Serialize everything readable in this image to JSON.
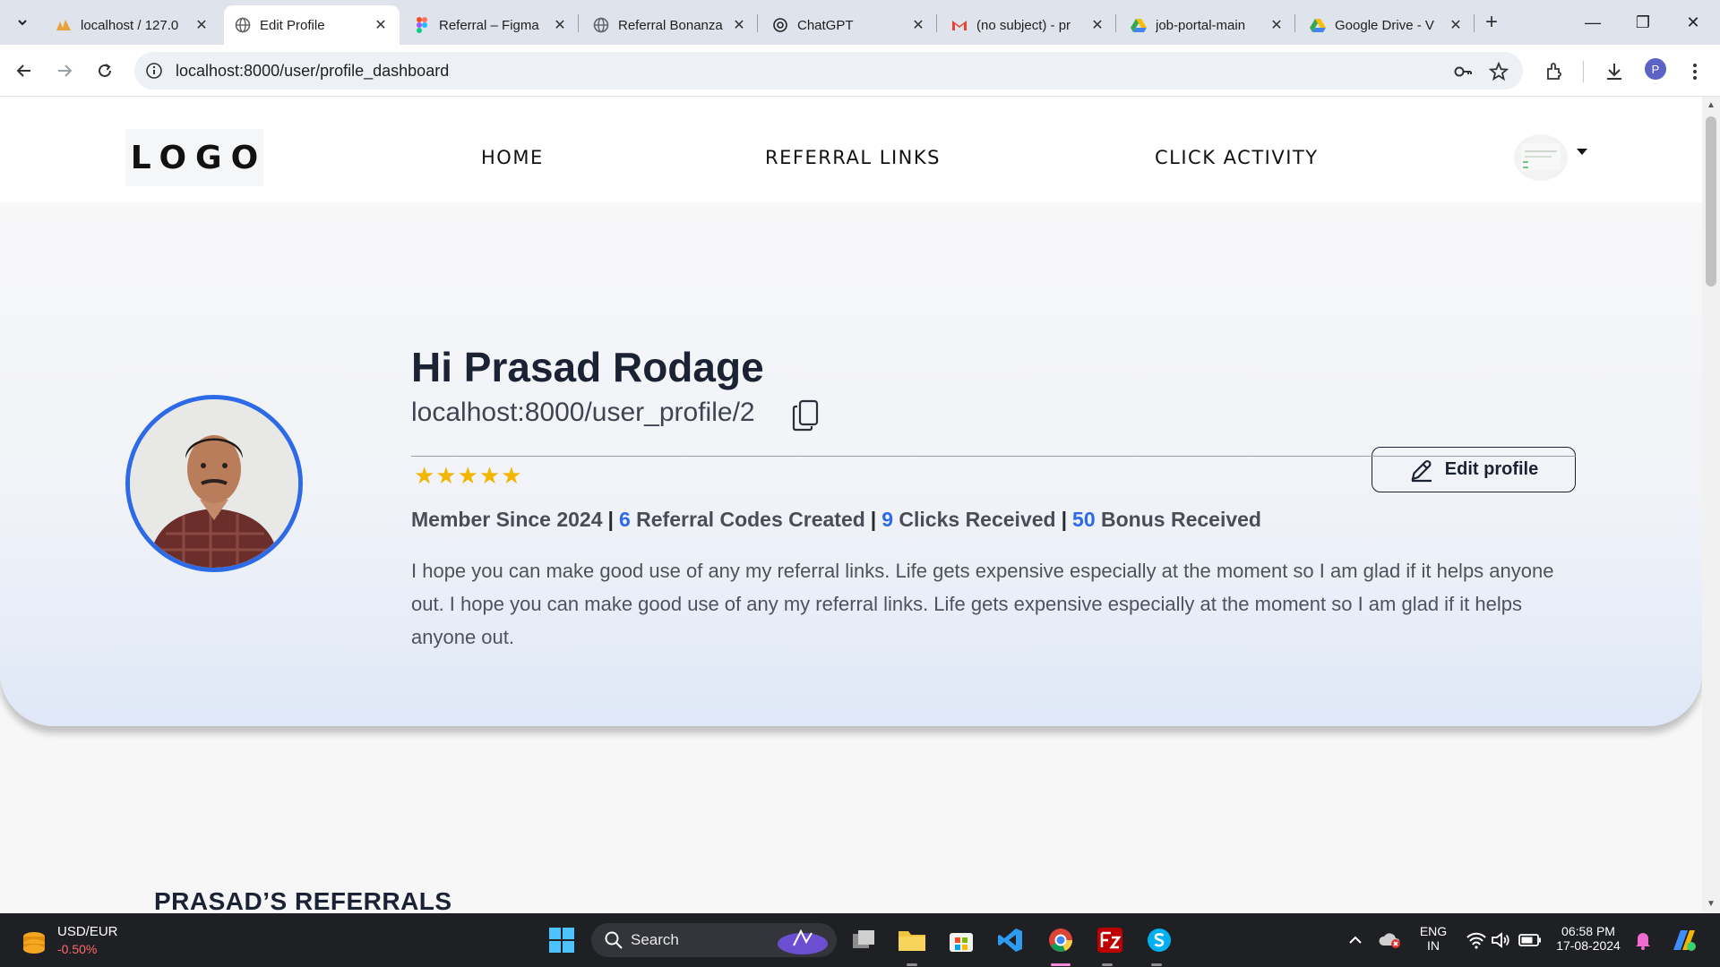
{
  "browser": {
    "tabs": [
      {
        "title": "localhost / 127.0",
        "icon": "phpmyadmin-icon",
        "active": false
      },
      {
        "title": "Edit Profile",
        "icon": "globe-icon",
        "active": true
      },
      {
        "title": "Referral – Figma",
        "icon": "figma-icon",
        "active": false
      },
      {
        "title": "Referral Bonanza",
        "icon": "globe-icon",
        "active": false
      },
      {
        "title": "ChatGPT",
        "icon": "chatgpt-icon",
        "active": false
      },
      {
        "title": "(no subject) - pr",
        "icon": "gmail-icon",
        "active": false
      },
      {
        "title": "job-portal-main",
        "icon": "drive-icon",
        "active": false
      },
      {
        "title": "Google Drive - V",
        "icon": "drive-icon",
        "active": false
      }
    ],
    "url": "localhost:8000/user/profile_dashboard",
    "profile_initial": "P"
  },
  "site": {
    "logo": "LOGO",
    "nav": {
      "home": "HOME",
      "referral_links": "REFERRAL LINKS",
      "click_activity": "CLICK ACTIVITY"
    }
  },
  "profile": {
    "greeting": "Hi Prasad Rodage",
    "url": "localhost:8000/user_profile/2",
    "stars": "★★★★★",
    "rating": 5,
    "edit_label": "Edit profile",
    "stats": {
      "member_since": "Member Since 2024",
      "referral_codes_count": "6",
      "referral_codes_label": "Referral Codes Created",
      "clicks_count": "9",
      "clicks_label": "Clicks Received",
      "bonus_count": "50",
      "bonus_label": "Bonus Received",
      "separator": "|"
    },
    "bio": "I hope you can make good use of any my referral links. Life gets expensive especially at the moment so I am glad if it helps anyone out. I hope you can make good use of any my referral links. Life gets expensive especially at the moment so I am glad if it helps anyone out."
  },
  "referrals": {
    "section_title": "PRASAD’S REFERRALS"
  },
  "taskbar": {
    "ticker_symbol": "USD/EUR",
    "ticker_change": "-0.50%",
    "search_label": "Search",
    "lang_top": "ENG",
    "lang_bottom": "IN",
    "time": "06:58 PM",
    "date": "17-08-2024"
  },
  "colors": {
    "accent": "#2d6ae8",
    "star": "#f2b600",
    "heading": "#1b2233",
    "taskbar": "#1f2024"
  }
}
